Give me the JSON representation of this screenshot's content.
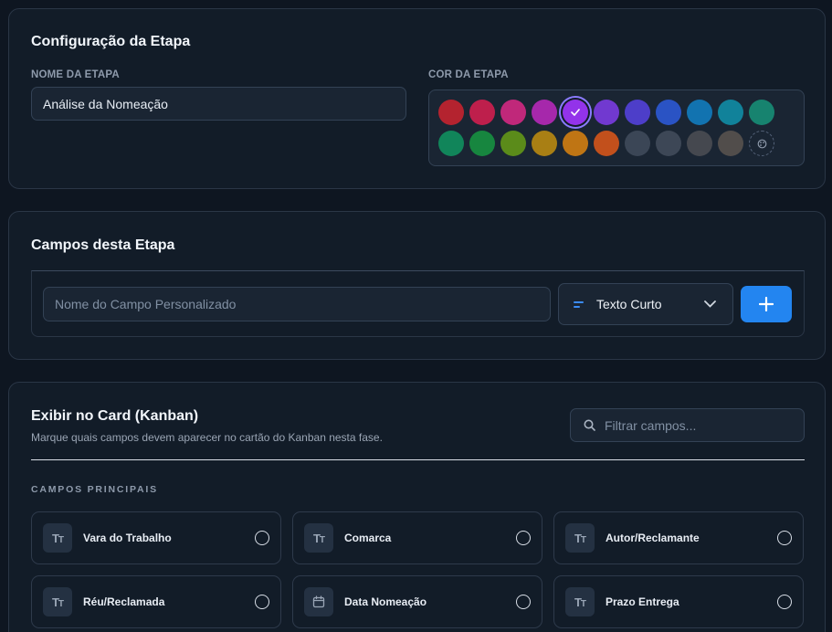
{
  "config": {
    "title": "Configuração da Etapa",
    "name_label": "NOME DA ETAPA",
    "name_value": "Análise da Nomeação",
    "color_label": "COR DA ETAPA",
    "selected_color": "#9333ea",
    "colors": [
      [
        "#b4232f",
        "#be1f4c",
        "#c0287a",
        "#a628ab",
        "#9333ea",
        "#7139d0",
        "#4d3ec9",
        "#2a53c4",
        "#1273b0",
        "#11829a",
        "#17836f"
      ],
      [
        "#11855a",
        "#17863f",
        "#5b8b1a",
        "#a97f14",
        "#bf7514",
        "#c2501c",
        "#3b4656",
        "#3d4756",
        "#45484f",
        "#514d4b"
      ]
    ]
  },
  "fields": {
    "title": "Campos desta Etapa",
    "name_placeholder": "Nome do Campo Personalizado",
    "type_value": "Texto Curto",
    "type_icon": "short-text-icon",
    "add_icon": "plus-icon"
  },
  "kanban": {
    "title": "Exibir no Card (Kanban)",
    "subtitle": "Marque quais campos devem aparecer no cartão do Kanban nesta fase.",
    "filter_placeholder": "Filtrar campos...",
    "section_label": "CAMPOS PRINCIPAIS",
    "items": [
      {
        "label": "Vara do Trabalho",
        "icon": "Tт"
      },
      {
        "label": "Comarca",
        "icon": "Tт"
      },
      {
        "label": "Autor/Reclamante",
        "icon": "Tт"
      },
      {
        "label": "Réu/Reclamada",
        "icon": "Tт"
      },
      {
        "label": "Data Nomeação",
        "icon": "calendar"
      },
      {
        "label": "Prazo Entrega",
        "icon": "Tт"
      }
    ]
  }
}
